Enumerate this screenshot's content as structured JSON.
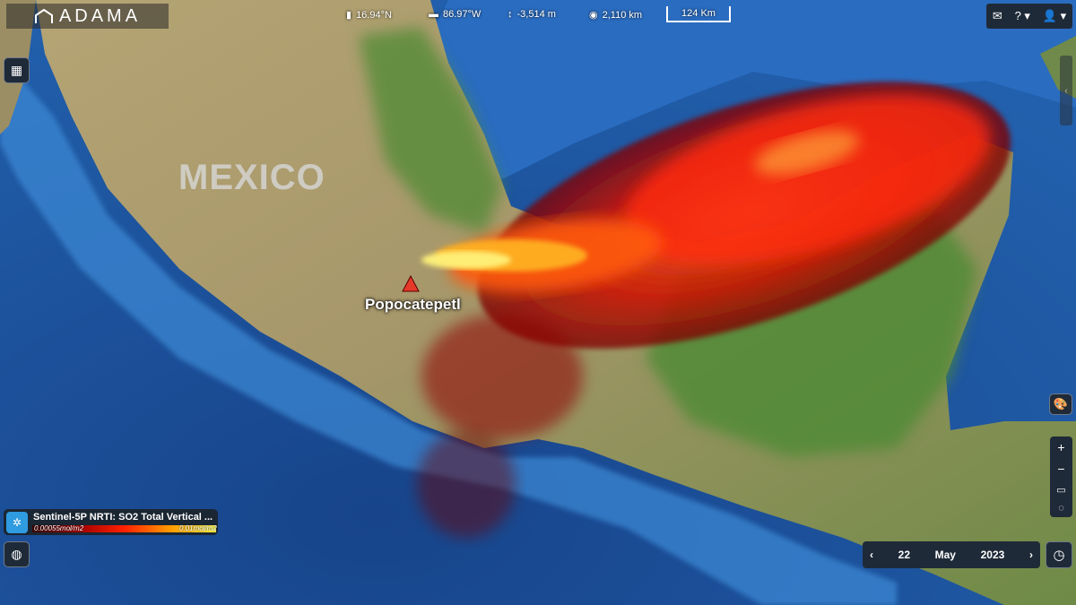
{
  "header": {
    "logo_text": "ADAMA",
    "latitude": "16.94°N",
    "longitude": "86.97°W",
    "elevation": "-3,514 m",
    "altitude": "2,110 km",
    "scale": "124 Km"
  },
  "map": {
    "country_label": "MEXICO",
    "volcano_label": "Popocatepetl"
  },
  "layer": {
    "title": "Sentinel-5P NRTI: SO2 Total Vertical ...",
    "min": "0.00055mol/m2",
    "max": "0.01mol/m2"
  },
  "date": {
    "day": "22",
    "month": "May",
    "year": "2023"
  },
  "colors": {
    "ocean_deep": "#1b4f93",
    "ocean_shallow": "#3a86d0",
    "land_dry": "#a89968",
    "land_green": "#5a8a3a",
    "plume_core": "#fff27a",
    "plume_mid": "#ff3a10",
    "plume_edge": "#8a0000",
    "volcano_marker": "#e53a2a",
    "ui_panel": "#1f2a38"
  },
  "icons": [
    "location-icon",
    "longitude-icon",
    "elevation-icon",
    "eye-icon",
    "map-layers-icon",
    "mail-icon",
    "help-icon",
    "user-icon",
    "palette-icon",
    "globe-icon",
    "clock-icon",
    "vr-icon",
    "rotate-icon"
  ]
}
